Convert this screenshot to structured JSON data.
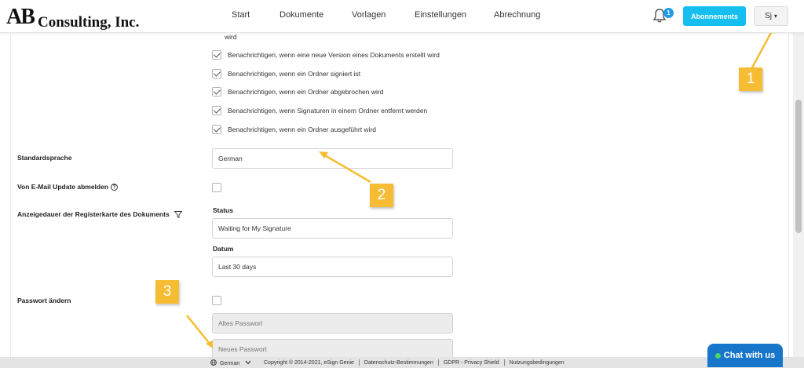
{
  "header": {
    "logo_initials": "AB",
    "logo_text": "Consulting, Inc.",
    "nav": [
      "Start",
      "Dokumente",
      "Vorlagen",
      "Einstellungen",
      "Abrechnung"
    ],
    "notification_count": "1",
    "subscriptions_button": "Abonnements",
    "user_initials": "Sj",
    "user_caret": "▾"
  },
  "notifications": {
    "wrap_text": "wird",
    "items": [
      {
        "label": "Benachrichtigen, wenn eine neue Version eines Dokuments erstellt wird",
        "checked": true
      },
      {
        "label": "Benachrichtigen, wenn ein Ordner signiert ist",
        "checked": true
      },
      {
        "label": "Benachrichtigen, wenn ein Ordner abgebrochen wird",
        "checked": true
      },
      {
        "label": "Benachrichtigen, wenn Signaturen in einem Ordner entfernt werden",
        "checked": true
      },
      {
        "label": "Benachrichtigen, wenn ein Ordner ausgeführt wird",
        "checked": true
      }
    ]
  },
  "settings": {
    "language_label": "Standardsprache",
    "language_value": "German",
    "unsubscribe_label": "Von E-Mail Update abmelden",
    "unsubscribe_checked": false,
    "tab_duration_label": "Anzeigedauer der Registerkarte des Dokuments",
    "status_label": "Status",
    "status_value": "Waiting for My Signature",
    "date_label": "Datum",
    "date_value": "Last 30 days",
    "password_label": "Passwort ändern",
    "password_checked": false,
    "old_password_placeholder": "Altes Passwort",
    "new_password_placeholder": "Neues Passwort"
  },
  "callouts": [
    "1",
    "2",
    "3"
  ],
  "footer": {
    "language": "German",
    "copyright": "Copyright © 2014-2021, eSign Genie",
    "links": [
      "Datenschutz-Bestimmungen",
      "GDPR - Privacy Shield",
      "Nutzungsbedingungen"
    ]
  },
  "chat": {
    "label": "Chat with us"
  },
  "colors": {
    "accent": "#15bff0",
    "callout": "#f6bd34",
    "chat": "#1776c9",
    "badge": "#1e9be8"
  },
  "icons": [
    "bell-icon",
    "help-icon",
    "filter-icon",
    "globe-icon",
    "chevron-down-icon"
  ]
}
